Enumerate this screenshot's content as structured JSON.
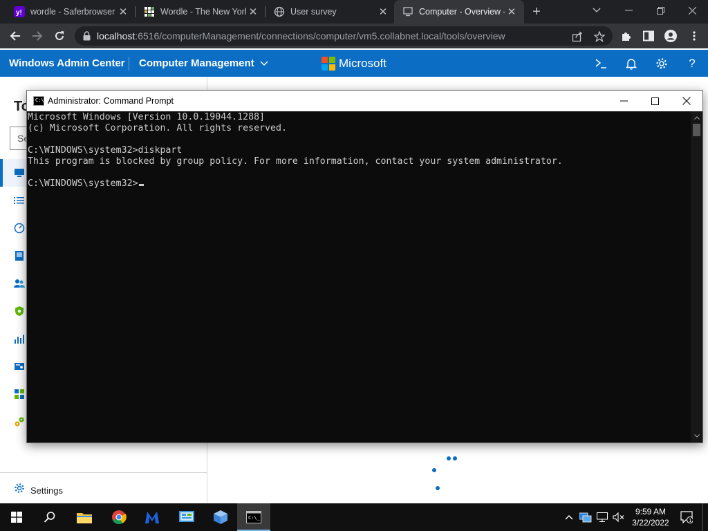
{
  "browser": {
    "tabs": [
      {
        "title": "wordle - Saferbrowser",
        "icon": "yahoo-icon",
        "active": false
      },
      {
        "title": "Wordle - The New York",
        "icon": "wordle-grid-icon",
        "active": false
      },
      {
        "title": "User survey",
        "icon": "globe-icon",
        "active": false
      },
      {
        "title": "Computer - Overview -",
        "icon": "page-icon",
        "active": true
      }
    ],
    "url_host": "localhost",
    "url_path": ":6516/computerManagement/connections/computer/vm5.collabnet.local/tools/overview"
  },
  "wac": {
    "app_title": "Windows Admin Center",
    "section_title": "Computer Management",
    "brand": "Microsoft",
    "brand_colors": [
      "#f25022",
      "#7fba00",
      "#00a4ef",
      "#ffb900"
    ],
    "accent": "#0b6dc4",
    "tools_heading": "To",
    "search_placeholder": "Se",
    "settings_label": "Settings"
  },
  "cmd": {
    "title": "Administrator: Command Prompt",
    "lines": [
      "Microsoft Windows [Version 10.0.19044.1288]",
      "(c) Microsoft Corporation. All rights reserved.",
      "",
      "C:\\WINDOWS\\system32>diskpart",
      "This program is blocked by group policy. For more information, contact your system administrator.",
      "",
      "C:\\WINDOWS\\system32>"
    ]
  },
  "taskbar": {
    "time": "9:59 AM",
    "date": "3/22/2022",
    "notification_count": "1"
  }
}
